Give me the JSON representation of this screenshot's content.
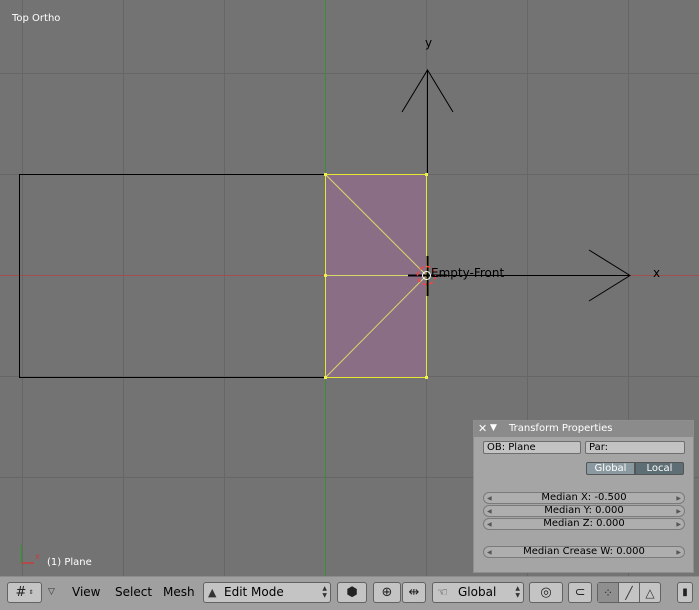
{
  "viewport": {
    "view_name": "Top Ortho",
    "active_object": "(1) Plane",
    "empty_label": "Empty-Front",
    "axis_y_label": "y",
    "axis_x_label": "x",
    "colors": {
      "background": "#737373",
      "grid": "#666666",
      "x_axis": "#a05050",
      "y_axis": "#3c8c3c",
      "face": "#8a6e86",
      "selected_edge": "#e6e632"
    }
  },
  "panel": {
    "title": "Transform Properties",
    "close_icon": "close-icon",
    "collapse_icon": "triangle-down-icon",
    "ob": "OB: Plane",
    "par": "Par:",
    "global_label": "Global",
    "local_label": "Local",
    "median_x": "Median X: -0.500",
    "median_y": "Median Y: 0.000",
    "median_z": "Median Z: 0.000",
    "median_crease": "Median Crease W: 0.000"
  },
  "header": {
    "menus": [
      "View",
      "Select",
      "Mesh"
    ],
    "mode": "Edit Mode",
    "orientation": "Global",
    "icons": {
      "editor_type": "grid-icon",
      "mode": "mesh-mode-icon",
      "orientation": "hand-icon",
      "pivot": "crosshair-icon",
      "proportional": "target-icon",
      "snap": "magnet-icon"
    }
  }
}
